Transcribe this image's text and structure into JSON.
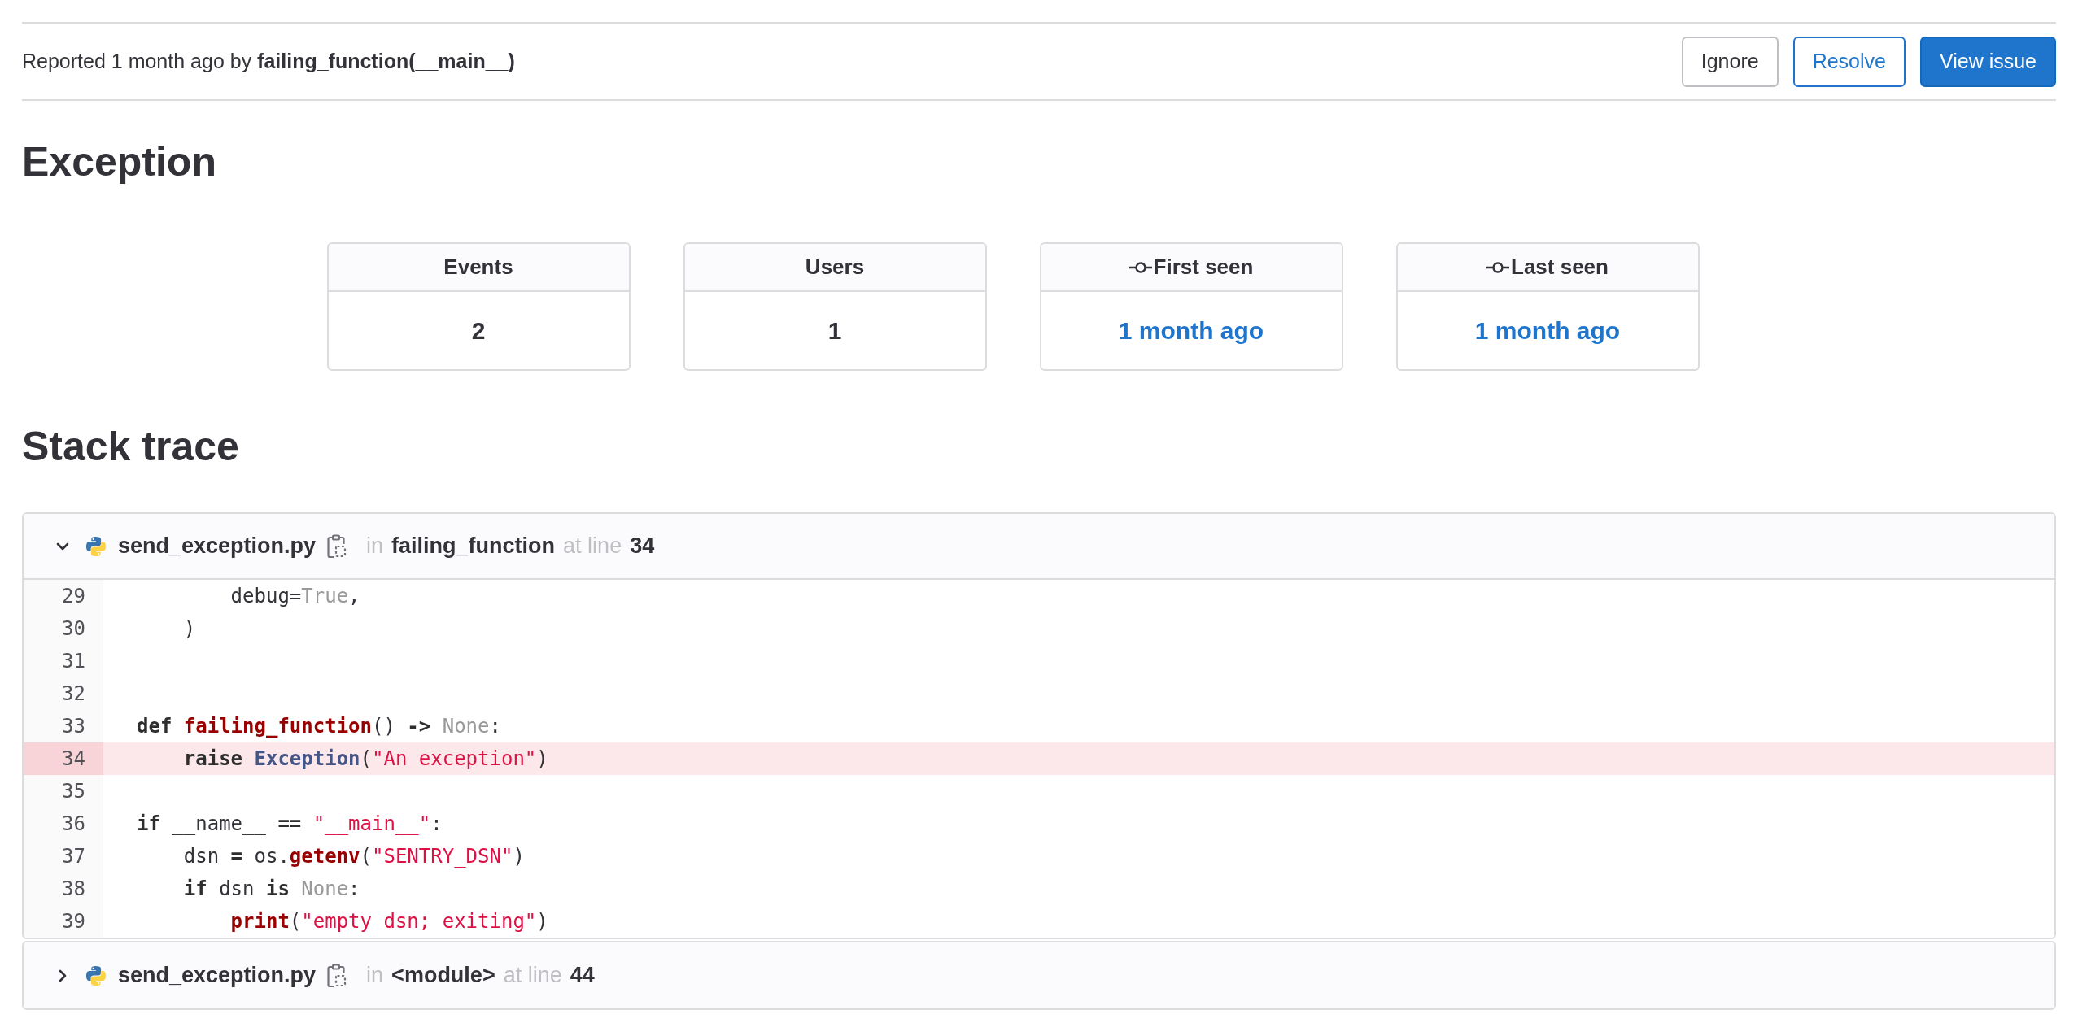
{
  "header": {
    "reported": "Reported 1 month ago by **failing_function(__main__)**",
    "buttons": [
      {
        "label": "Ignore",
        "kind": "default"
      },
      {
        "label": "Resolve",
        "kind": "outline"
      },
      {
        "label": "View issue",
        "kind": "primary"
      }
    ]
  },
  "title": "Exception",
  "stats": [
    {
      "label": "Events",
      "value": "2",
      "kind": "count"
    },
    {
      "label": "Users",
      "value": "1",
      "kind": "count"
    },
    {
      "label": "First seen",
      "value": "1 month ago",
      "kind": "time"
    },
    {
      "label": "Last seen",
      "value": "1 month ago",
      "kind": "time"
    }
  ],
  "stack_title": "Stack trace",
  "frames": [
    {
      "expanded": true,
      "file": "send_exception.py",
      "in": "in",
      "function": "failing_function",
      "at": "at line",
      "line": "34",
      "code": [
        {
          "number": "29",
          "highlighted": false,
          "tokens": [
            {
              "kind": "plain",
              "text": "        debug="
            },
            {
              "kind": "const",
              "text": "True"
            },
            {
              "kind": "plain",
              "text": ","
            }
          ]
        },
        {
          "number": "30",
          "highlighted": false,
          "tokens": [
            {
              "kind": "plain",
              "text": "    )"
            }
          ]
        },
        {
          "number": "31",
          "highlighted": false
        },
        {
          "number": "32",
          "highlighted": false
        },
        {
          "number": "33",
          "highlighted": false,
          "tokens": [
            {
              "kind": "keyword",
              "text": "def"
            },
            {
              "kind": "func",
              "text": " failing_function"
            },
            {
              "kind": "plain",
              "text": "() "
            },
            {
              "kind": "keyword",
              "text": "->"
            },
            {
              "kind": "const",
              "text": " None"
            },
            {
              "kind": "plain",
              "text": ":"
            }
          ]
        },
        {
          "number": "34",
          "highlighted": true,
          "tokens": [
            {
              "kind": "keyword",
              "text": "    raise"
            },
            {
              "kind": "class",
              "text": " Exception"
            },
            {
              "kind": "plain",
              "text": "("
            },
            {
              "kind": "string",
              "text": "\"An exception\""
            },
            {
              "kind": "plain",
              "text": ")"
            }
          ]
        },
        {
          "number": "35",
          "highlighted": false
        },
        {
          "number": "36",
          "highlighted": false,
          "tokens": [
            {
              "kind": "keyword",
              "text": "if"
            },
            {
              "kind": "plain",
              "text": " __name__ "
            },
            {
              "kind": "keyword",
              "text": "=="
            },
            {
              "kind": "string",
              "text": " \"__main__\""
            },
            {
              "kind": "plain",
              "text": ":"
            }
          ]
        },
        {
          "number": "37",
          "highlighted": false,
          "tokens": [
            {
              "kind": "plain",
              "text": "    dsn "
            },
            {
              "kind": "keyword",
              "text": "="
            },
            {
              "kind": "plain",
              "text": " os."
            },
            {
              "kind": "func",
              "text": "getenv"
            },
            {
              "kind": "plain",
              "text": "("
            },
            {
              "kind": "string",
              "text": "\"SENTRY_DSN\""
            },
            {
              "kind": "plain",
              "text": ")"
            }
          ]
        },
        {
          "number": "38",
          "highlighted": false,
          "tokens": [
            {
              "kind": "keyword",
              "text": "    if"
            },
            {
              "kind": "plain",
              "text": " dsn "
            },
            {
              "kind": "keyword",
              "text": "is"
            },
            {
              "kind": "const",
              "text": " None"
            },
            {
              "kind": "plain",
              "text": ":"
            }
          ]
        },
        {
          "number": "39",
          "highlighted": false,
          "tokens": [
            {
              "kind": "func",
              "text": "        print"
            },
            {
              "kind": "plain",
              "text": "("
            },
            {
              "kind": "string",
              "text": "\"empty dsn; exiting\""
            },
            {
              "kind": "plain",
              "text": ")"
            }
          ]
        }
      ]
    },
    {
      "expanded": false,
      "file": "send_exception.py",
      "in": "in",
      "function": "<module>",
      "at": "at line",
      "line": "44"
    }
  ]
}
